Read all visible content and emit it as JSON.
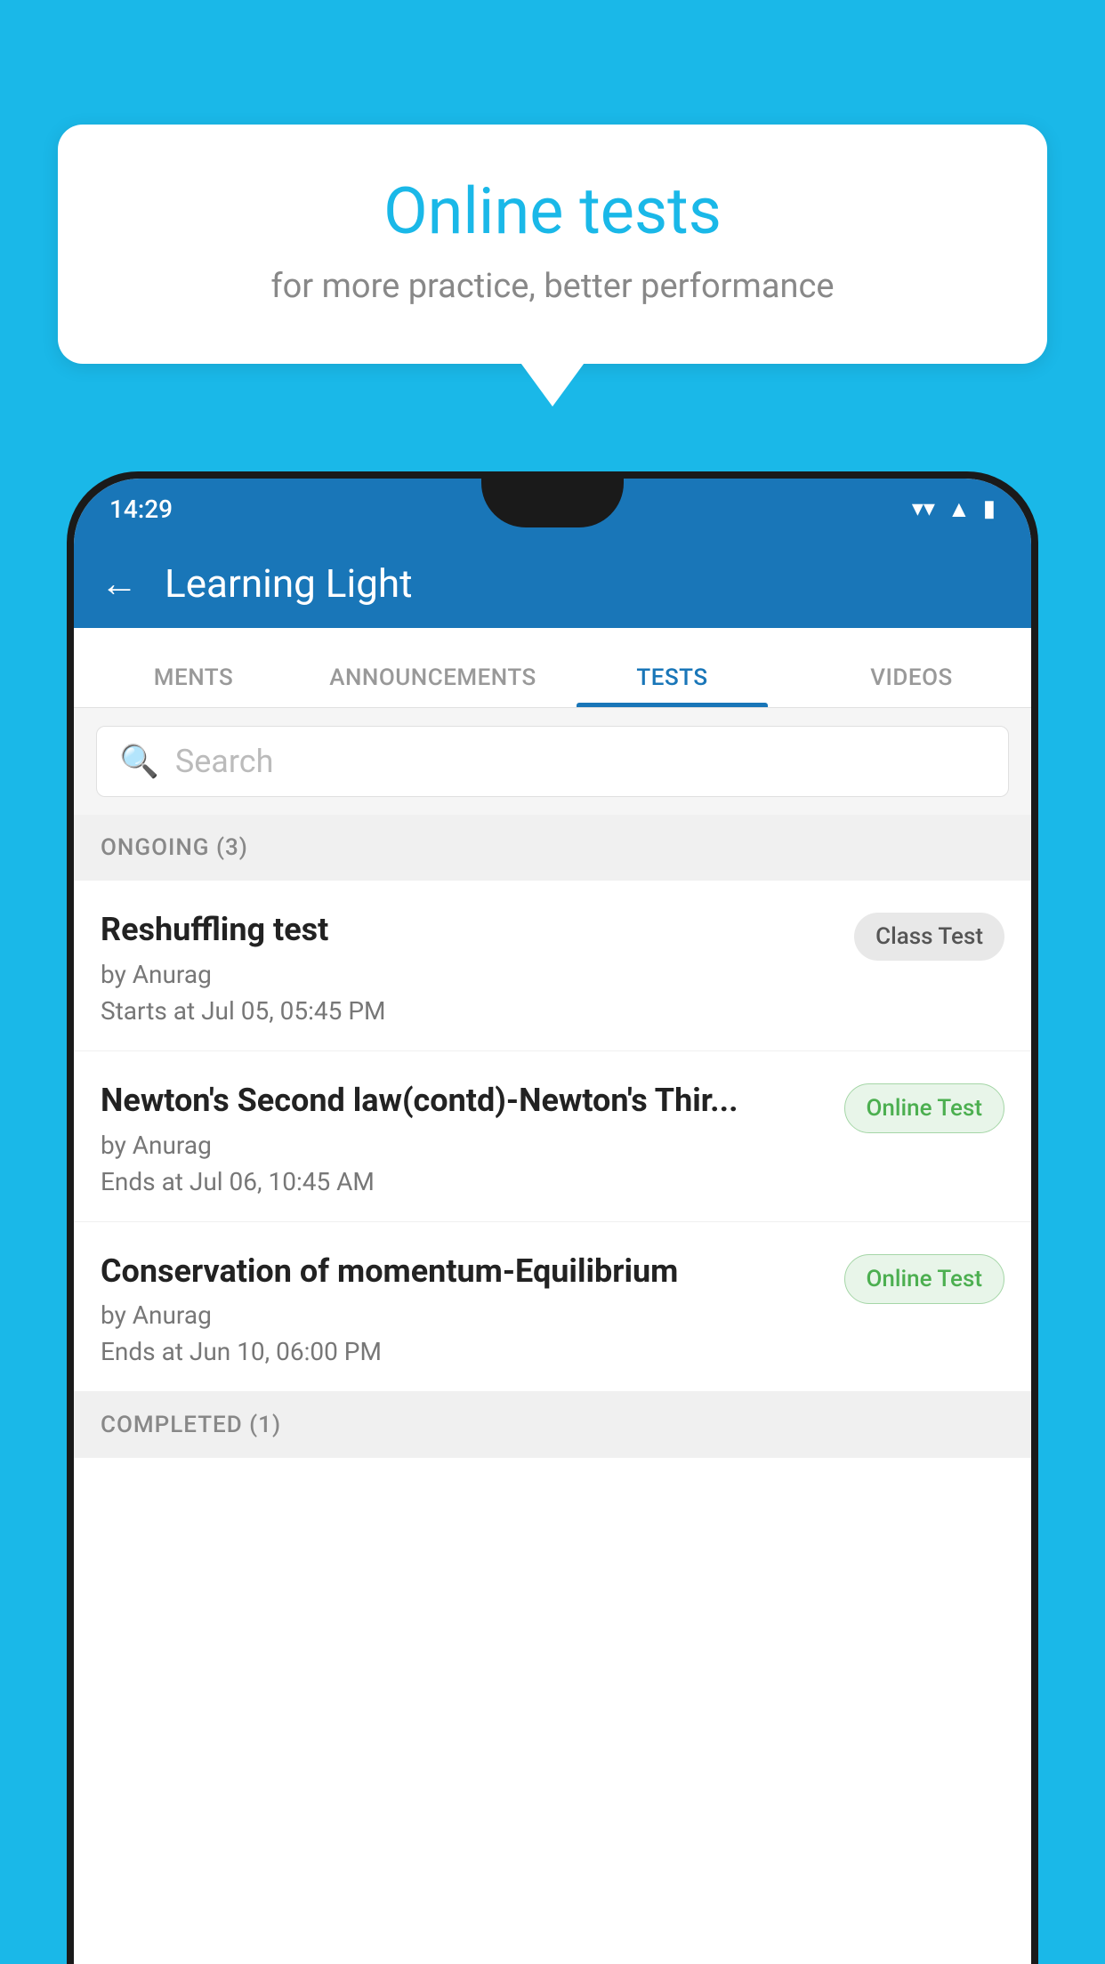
{
  "background": {
    "color": "#1ab8e8"
  },
  "speech_bubble": {
    "title": "Online tests",
    "subtitle": "for more practice, better performance"
  },
  "phone": {
    "status_bar": {
      "time": "14:29",
      "wifi_icon": "▼",
      "signal_icon": "◂",
      "battery_icon": "▮"
    },
    "header": {
      "back_label": "←",
      "title": "Learning Light"
    },
    "tabs": [
      {
        "label": "MENTS",
        "active": false
      },
      {
        "label": "ANNOUNCEMENTS",
        "active": false
      },
      {
        "label": "TESTS",
        "active": true
      },
      {
        "label": "VIDEOS",
        "active": false
      }
    ],
    "search": {
      "placeholder": "Search"
    },
    "ongoing_section": {
      "label": "ONGOING (3)"
    },
    "tests": [
      {
        "title": "Reshuffling test",
        "author": "by Anurag",
        "date": "Starts at  Jul 05, 05:45 PM",
        "badge": "Class Test",
        "badge_type": "class"
      },
      {
        "title": "Newton's Second law(contd)-Newton's Thir...",
        "author": "by Anurag",
        "date": "Ends at  Jul 06, 10:45 AM",
        "badge": "Online Test",
        "badge_type": "online"
      },
      {
        "title": "Conservation of momentum-Equilibrium",
        "author": "by Anurag",
        "date": "Ends at  Jun 10, 06:00 PM",
        "badge": "Online Test",
        "badge_type": "online"
      }
    ],
    "completed_section": {
      "label": "COMPLETED (1)"
    }
  }
}
